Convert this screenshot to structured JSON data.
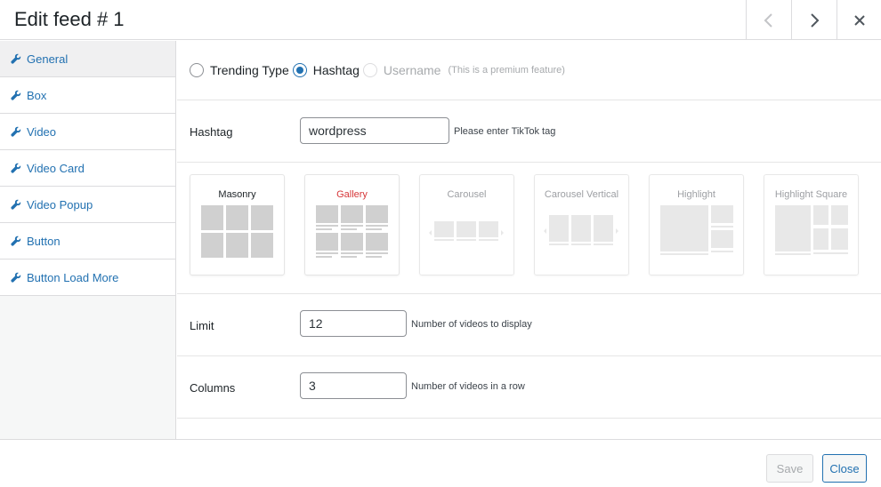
{
  "header": {
    "title": "Edit feed # 1",
    "prev_icon": "chevron-left-icon",
    "next_icon": "chevron-right-icon",
    "close_icon": "close-icon"
  },
  "sidebar": {
    "items": [
      {
        "label": "General",
        "icon": "wrench-icon",
        "active": true
      },
      {
        "label": "Box",
        "icon": "wrench-icon"
      },
      {
        "label": "Video",
        "icon": "wrench-icon"
      },
      {
        "label": "Video Card",
        "icon": "wrench-icon"
      },
      {
        "label": "Video Popup",
        "icon": "wrench-icon"
      },
      {
        "label": "Button",
        "icon": "wrench-icon"
      },
      {
        "label": "Button Load More",
        "icon": "wrench-icon"
      }
    ]
  },
  "general": {
    "type_options": [
      {
        "label": "Trending Type",
        "checked": false
      },
      {
        "label": "Hashtag",
        "checked": true
      },
      {
        "label": "Username",
        "checked": false,
        "disabled": true
      }
    ],
    "premium_note": "(This is a premium feature)",
    "hashtag": {
      "label": "Hashtag",
      "value": "wordpress",
      "description": "Please enter TikTok tag"
    },
    "layouts": [
      {
        "label": "Masonry",
        "state": "normal"
      },
      {
        "label": "Gallery",
        "state": "selected"
      },
      {
        "label": "Carousel",
        "state": "disabled"
      },
      {
        "label": "Carousel Vertical",
        "state": "disabled"
      },
      {
        "label": "Highlight",
        "state": "disabled"
      },
      {
        "label": "Highlight Square",
        "state": "disabled"
      }
    ],
    "limit": {
      "label": "Limit",
      "value": "12",
      "description": "Number of videos to display"
    },
    "columns": {
      "label": "Columns",
      "value": "3",
      "description": "Number of videos in a row"
    }
  },
  "footer": {
    "save_label": "Save",
    "close_label": "Close"
  },
  "colors": {
    "link": "#2271b1",
    "selected_layout": "#d63638",
    "border": "#dcdcde"
  }
}
